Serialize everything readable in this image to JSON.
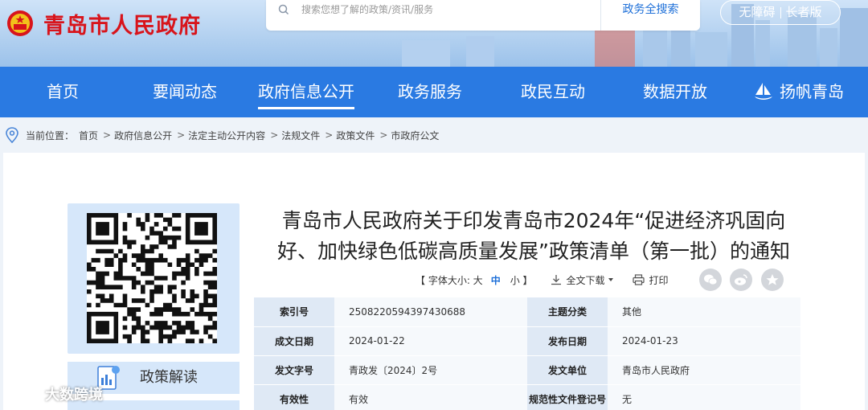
{
  "header": {
    "site_name": "青岛市人民政府",
    "search_placeholder": "搜索您想了解的政策/资讯/服务",
    "search_button": "政务全搜索",
    "accessibility": "无障碍",
    "elder_mode": "长者版"
  },
  "nav": {
    "items": [
      "首页",
      "要闻动态",
      "政府信息公开",
      "政务服务",
      "政民互动",
      "数据开放",
      "扬帆青岛"
    ],
    "active_index": 2
  },
  "breadcrumb": {
    "prefix": "当前位置：",
    "items": [
      "首页",
      "政府信息公开",
      "法定主动公开内容",
      "法规文件",
      "政策文件",
      "市政府公文"
    ]
  },
  "sidebar": {
    "tab_label": "政策解读"
  },
  "article": {
    "title_line1": "青岛市人民政府关于印发青岛市2024年“促进经济巩固向",
    "title_line2": "好、加快绿色低碳高质量发展”政策清单（第一批）的通知",
    "tools": {
      "font_size_label": "【 字体大小: 大",
      "size_medium": "中",
      "size_small": "小 】",
      "download": "全文下载",
      "print": "打印"
    }
  },
  "meta": {
    "rows": [
      {
        "k1": "索引号",
        "v1": "2508220594397430688",
        "k2": "主题分类",
        "v2": "其他"
      },
      {
        "k1": "成文日期",
        "v1": "2024-01-22",
        "k2": "发布日期",
        "v2": "2024-01-23"
      },
      {
        "k1": "发文字号",
        "v1": "青政发〔2024〕2号",
        "k2": "发文单位",
        "v2": "青岛市人民政府"
      },
      {
        "k1": "有效性",
        "v1": "有效",
        "k2": "规范性文件登记号",
        "v2": "无"
      }
    ]
  },
  "watermark": "大数跨境",
  "colors": {
    "brand_red": "#d8141b",
    "nav_blue": "#2a7ae2",
    "link_blue": "#1d6fd8",
    "side_panel": "#d6e7fa"
  }
}
